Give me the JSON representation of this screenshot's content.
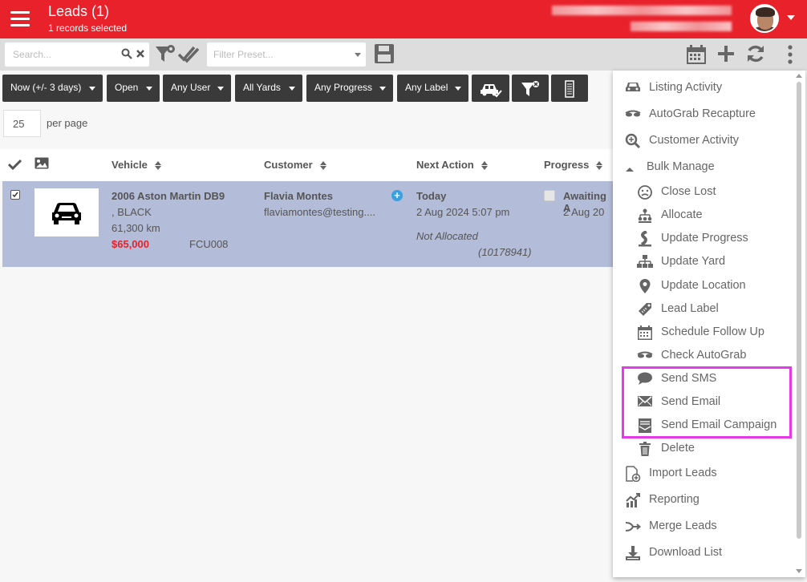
{
  "header": {
    "title": "Leads (1)",
    "subtitle": "1 records selected"
  },
  "toolbar": {
    "search_placeholder": "Search...",
    "preset_placeholder": "Filter Preset..."
  },
  "filters": {
    "date": "Now (+/- 3 days)",
    "status": "Open",
    "user": "Any User",
    "yard": "All Yards",
    "progress": "Any Progress",
    "label": "Any Label"
  },
  "pagination": {
    "per_page_value": "25",
    "per_page_label": "per page"
  },
  "table": {
    "columns": [
      "Vehicle",
      "Customer",
      "Next Action",
      "Progress"
    ],
    "rows": [
      {
        "vehicle": "2006 Aston Martin DB9",
        "colour": ", BLACK",
        "km": "61,300 km",
        "price": "$65,000",
        "stock": "FCU008",
        "customer_name": "Flavia Montes",
        "customer_email": "flaviamontes@testing....",
        "next_action": "Today",
        "next_date": "2 Aug 2024 5:07 pm",
        "allocation": "Not Allocated",
        "lead_id": "(10178941)",
        "progress": "Awaiting A",
        "progress_date": "2 Aug 20"
      }
    ]
  },
  "menu": {
    "items": [
      {
        "label": "Listing Activity",
        "icon": "car-icon"
      },
      {
        "label": "AutoGrab Recapture",
        "icon": "glasses-icon"
      },
      {
        "label": "Customer Activity",
        "icon": "magnify-icon"
      },
      {
        "label": "Bulk Manage",
        "icon": "caret-up-icon"
      },
      {
        "label": "Close Lost",
        "icon": "sad-face-icon"
      },
      {
        "label": "Allocate",
        "icon": "org-chart-icon"
      },
      {
        "label": "Update Progress",
        "icon": "road-icon"
      },
      {
        "label": "Update Yard",
        "icon": "sitemap-icon"
      },
      {
        "label": "Update Location",
        "icon": "map-pin-icon"
      },
      {
        "label": "Lead Label",
        "icon": "tag-icon"
      },
      {
        "label": "Schedule Follow Up",
        "icon": "calendar-icon"
      },
      {
        "label": "Check AutoGrab",
        "icon": "glasses-icon"
      },
      {
        "label": "Send SMS",
        "icon": "chat-bubble-icon"
      },
      {
        "label": "Send Email",
        "icon": "envelope-icon"
      },
      {
        "label": "Send Email Campaign",
        "icon": "campaign-icon"
      },
      {
        "label": "Delete",
        "icon": "trash-icon"
      },
      {
        "label": "Import Leads",
        "icon": "import-icon"
      },
      {
        "label": "Reporting",
        "icon": "chart-icon"
      },
      {
        "label": "Merge Leads",
        "icon": "merge-icon"
      },
      {
        "label": "Download List",
        "icon": "download-icon"
      }
    ]
  },
  "colors": {
    "brand": "#e8212b",
    "row_selected": "#b3bcd9",
    "highlight": "#e43be8"
  }
}
